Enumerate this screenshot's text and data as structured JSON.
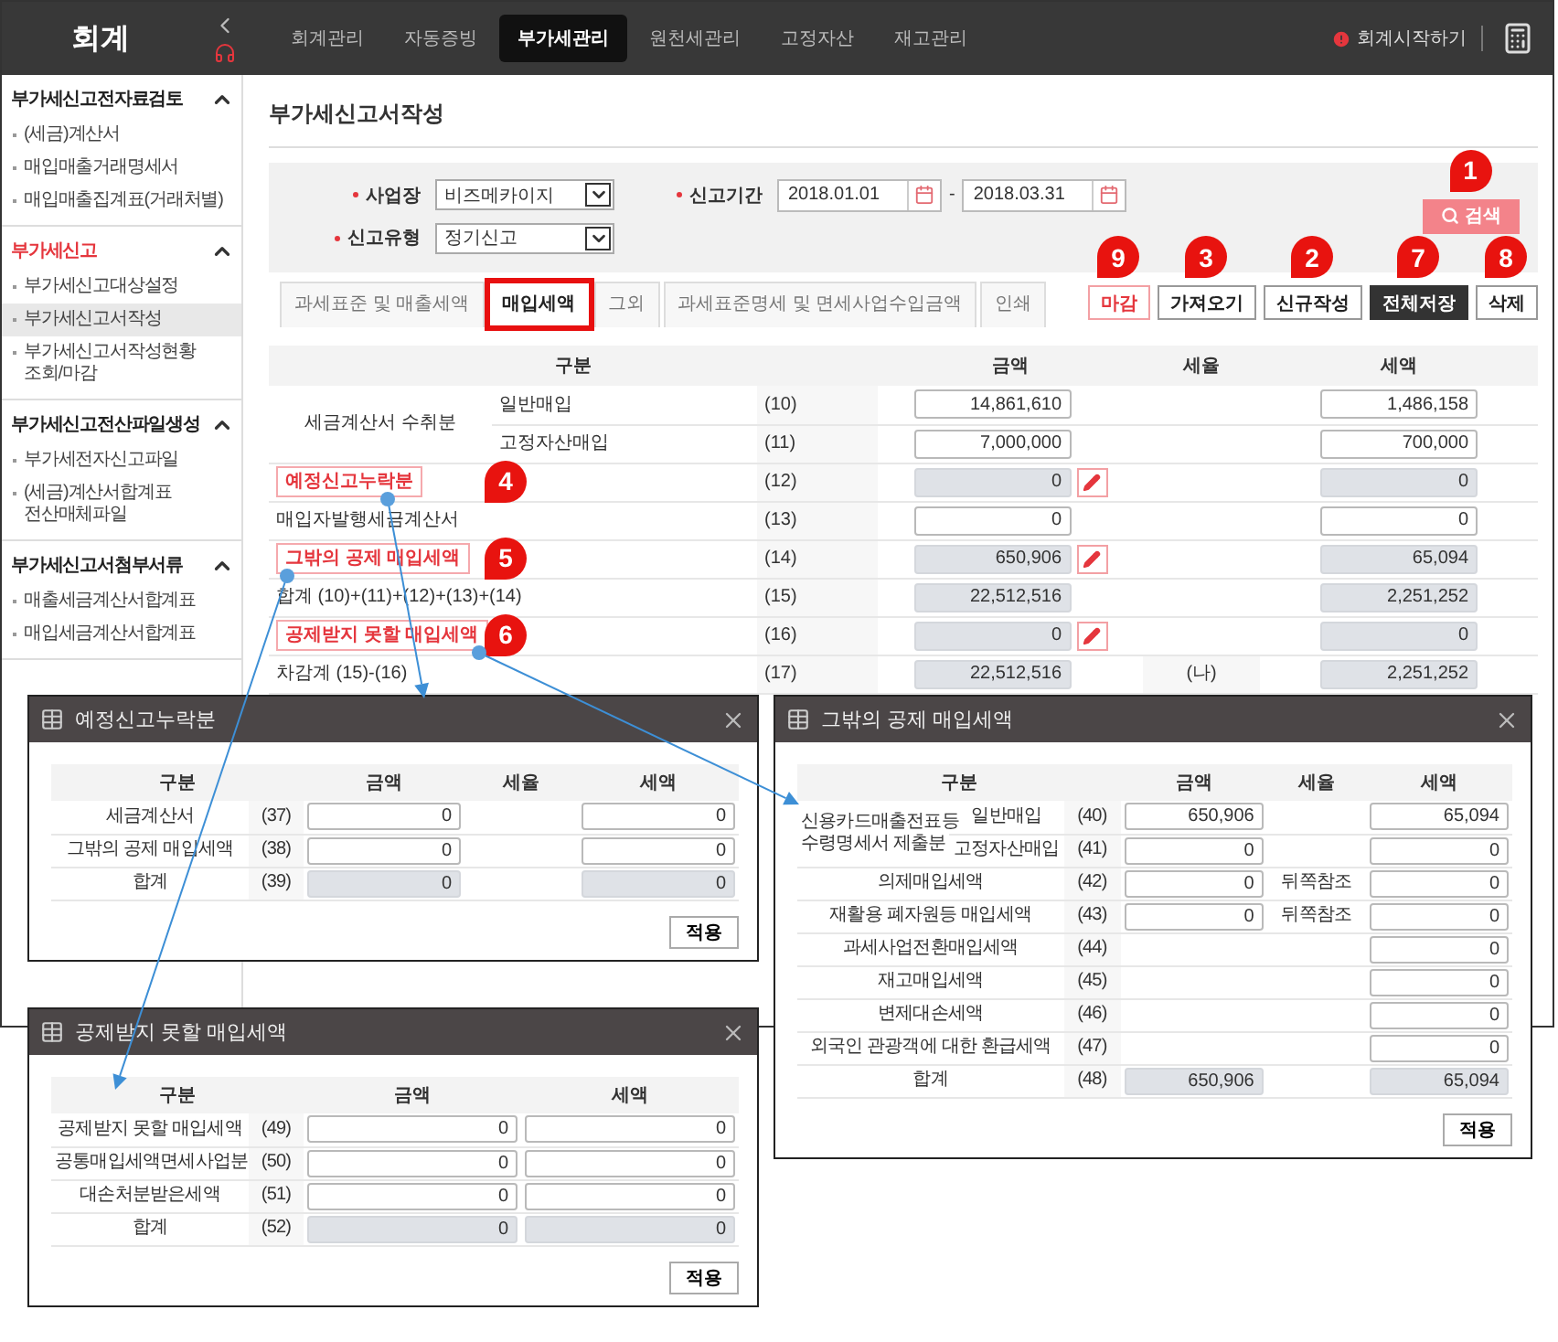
{
  "topbar": {
    "app_title": "회계",
    "menu": [
      {
        "label": "회계관리",
        "selected": false
      },
      {
        "label": "자동증빙",
        "selected": false
      },
      {
        "label": "부가세관리",
        "selected": true
      },
      {
        "label": "원천세관리",
        "selected": false
      },
      {
        "label": "고정자산",
        "selected": false
      },
      {
        "label": "재고관리",
        "selected": false
      }
    ],
    "start_link": "회계시작하기"
  },
  "sidebar": [
    {
      "title": "부가세신고전자료검토",
      "selected": false,
      "expanded": true,
      "items": [
        {
          "label": "(세금)계산서",
          "selected": false
        },
        {
          "label": "매입매출거래명세서",
          "selected": false
        },
        {
          "label": "매입매출집계표(거래처별)",
          "selected": false
        }
      ]
    },
    {
      "title": "부가세신고",
      "selected": true,
      "expanded": true,
      "items": [
        {
          "label": "부가세신고대상설정",
          "selected": false
        },
        {
          "label": "부가세신고서작성",
          "selected": true
        },
        {
          "label": "부가세신고서작성현황 조회/마감",
          "selected": false
        }
      ]
    },
    {
      "title": "부가세신고전산파일생성",
      "selected": false,
      "expanded": true,
      "items": [
        {
          "label": "부가세전자신고파일",
          "selected": false
        },
        {
          "label": "(세금)계산서합계표 전산매체파일",
          "selected": false
        }
      ]
    },
    {
      "title": "부가세신고서첨부서류",
      "selected": false,
      "expanded": true,
      "items": [
        {
          "label": "매출세금계산서합계표",
          "selected": false
        },
        {
          "label": "매입세금계산서합계표",
          "selected": false
        }
      ]
    }
  ],
  "page_title": "부가세신고서작성",
  "filters": {
    "business": {
      "label": "사업장",
      "value": "비즈메카이지"
    },
    "period": {
      "label": "신고기간",
      "from": "2018.01.01",
      "separator": "-",
      "to": "2018.03.31"
    },
    "report_type": {
      "label": "신고유형",
      "value": "정기신고"
    },
    "search_button": {
      "label": "검색",
      "callout": "1"
    }
  },
  "tabs": [
    {
      "label": "과세표준 및 매출세액",
      "selected": false,
      "highlighted": false
    },
    {
      "label": "매입세액",
      "selected": true,
      "highlighted": true
    },
    {
      "label": "그외",
      "selected": false,
      "highlighted": false
    },
    {
      "label": "과세표준명세 및 면세사업수입금액",
      "selected": false,
      "highlighted": false
    },
    {
      "label": "인쇄",
      "selected": false,
      "highlighted": false
    }
  ],
  "actions": [
    {
      "label": "마감",
      "kind": "accent",
      "callout": "9"
    },
    {
      "label": "가져오기",
      "kind": "plain",
      "callout": "3"
    },
    {
      "label": "신규작성",
      "kind": "plain",
      "callout": "2"
    },
    {
      "label": "전체저장",
      "kind": "dark",
      "callout": "7"
    },
    {
      "label": "삭제",
      "kind": "plain",
      "callout": "8"
    }
  ],
  "table": {
    "columns": [
      {
        "kind": "label",
        "label": "구분"
      },
      {
        "kind": "amount",
        "label": "금액"
      },
      {
        "kind": "rate",
        "label": "세율"
      },
      {
        "kind": "tax",
        "label": "세액"
      }
    ],
    "rows": [
      {
        "label": "세금계산서 수취분",
        "children": [
          {
            "label": "일반매입",
            "no": "(10)",
            "amount": {
              "value": "14,861,610",
              "readonly": false
            },
            "editable": false,
            "tax": {
              "value": "1,486,158",
              "readonly": false
            }
          },
          {
            "label": "고정자산매입",
            "no": "(11)",
            "amount": {
              "value": "7,000,000",
              "readonly": false
            },
            "editable": false,
            "tax": {
              "value": "700,000",
              "readonly": false
            }
          }
        ]
      },
      {
        "label": "예정신고누락분",
        "highlighted": true,
        "callout": "4",
        "no": "(12)",
        "amount": {
          "value": "0",
          "readonly": true
        },
        "editable": true,
        "tax": {
          "value": "0",
          "readonly": true
        }
      },
      {
        "label": "매입자발행세금계산서",
        "highlighted": false,
        "no": "(13)",
        "amount": {
          "value": "0",
          "readonly": false
        },
        "editable": false,
        "tax": {
          "value": "0",
          "readonly": false
        }
      },
      {
        "label": "그밖의 공제 매입세액",
        "highlighted": true,
        "callout": "5",
        "no": "(14)",
        "amount": {
          "value": "650,906",
          "readonly": true
        },
        "editable": true,
        "tax": {
          "value": "65,094",
          "readonly": true
        }
      },
      {
        "label": "합계 (10)+(11)+(12)+(13)+(14)",
        "highlighted": false,
        "no": "(15)",
        "amount": {
          "value": "22,512,516",
          "readonly": true
        },
        "editable": false,
        "tax": {
          "value": "2,251,252",
          "readonly": true
        }
      },
      {
        "label": "공제받지 못할 매입세액",
        "highlighted": true,
        "callout": "6",
        "no": "(16)",
        "amount": {
          "value": "0",
          "readonly": true
        },
        "editable": true,
        "tax": {
          "value": "0",
          "readonly": true
        }
      },
      {
        "label": "차감계 (15)-(16)",
        "highlighted": false,
        "no": "(17)",
        "amount": {
          "value": "22,512,516",
          "readonly": true
        },
        "editable": false,
        "rate": "(나)",
        "tax": {
          "value": "2,251,252",
          "readonly": true
        }
      }
    ]
  },
  "dialogs": [
    {
      "title": "예정신고누락분",
      "columns": [
        {
          "kind": "label",
          "label": "구분"
        },
        {
          "kind": "amount",
          "label": "금액"
        },
        {
          "kind": "rate",
          "label": "세율"
        },
        {
          "kind": "tax",
          "label": "세액"
        }
      ],
      "rows": [
        {
          "label": "세금계산서",
          "no": "(37)",
          "amount": {
            "value": "0",
            "readonly": false
          },
          "tax": {
            "value": "0",
            "readonly": false
          }
        },
        {
          "label": "그밖의 공제 매입세액",
          "no": "(38)",
          "amount": {
            "value": "0",
            "readonly": false
          },
          "tax": {
            "value": "0",
            "readonly": false
          }
        },
        {
          "label": "합계",
          "no": "(39)",
          "amount": {
            "value": "0",
            "readonly": true
          },
          "tax": {
            "value": "0",
            "readonly": true
          }
        }
      ],
      "apply_button": "적용"
    },
    {
      "title": "그밖의 공제 매입세액",
      "columns": [
        {
          "kind": "label",
          "label": "구분"
        },
        {
          "kind": "amount",
          "label": "금액"
        },
        {
          "kind": "rate",
          "label": "세율"
        },
        {
          "kind": "tax",
          "label": "세액"
        }
      ],
      "rows": [
        {
          "label": "신용카드매출전표등 수령명세서 제출분",
          "children": [
            {
              "label": "일반매입",
              "no": "(40)",
              "amount": {
                "value": "650,906",
                "readonly": false
              },
              "tax": {
                "value": "65,094",
                "readonly": false
              }
            },
            {
              "label": "고정자산매입",
              "no": "(41)",
              "amount": {
                "value": "0",
                "readonly": false
              },
              "tax": {
                "value": "0",
                "readonly": false
              }
            }
          ]
        },
        {
          "label": "의제매입세액",
          "no": "(42)",
          "amount": {
            "value": "0",
            "readonly": false
          },
          "rate": "뒤쪽참조",
          "tax": {
            "value": "0",
            "readonly": false
          }
        },
        {
          "label": "재활용 폐자원등 매입세액",
          "no": "(43)",
          "amount": {
            "value": "0",
            "readonly": false
          },
          "rate": "뒤쪽참조",
          "tax": {
            "value": "0",
            "readonly": false
          }
        },
        {
          "label": "과세사업전환매입세액",
          "no": "(44)",
          "tax": {
            "value": "0",
            "readonly": false
          }
        },
        {
          "label": "재고매입세액",
          "no": "(45)",
          "tax": {
            "value": "0",
            "readonly": false
          }
        },
        {
          "label": "변제대손세액",
          "no": "(46)",
          "tax": {
            "value": "0",
            "readonly": false
          }
        },
        {
          "label": "외국인 관광객에 대한 환급세액",
          "no": "(47)",
          "tax": {
            "value": "0",
            "readonly": false
          }
        },
        {
          "label": "합계",
          "no": "(48)",
          "amount": {
            "value": "650,906",
            "readonly": true
          },
          "tax": {
            "value": "65,094",
            "readonly": true
          }
        }
      ],
      "apply_button": "적용"
    },
    {
      "title": "공제받지 못할 매입세액",
      "columns": [
        {
          "kind": "label",
          "label": "구분"
        },
        {
          "kind": "amount",
          "label": "금액"
        },
        {
          "kind": "tax",
          "label": "세액"
        }
      ],
      "rows": [
        {
          "label": "공제받지 못할 매입세액",
          "no": "(49)",
          "amount": {
            "value": "0",
            "readonly": false
          },
          "tax": {
            "value": "0",
            "readonly": false
          }
        },
        {
          "label": "공통매입세액면세사업분",
          "no": "(50)",
          "amount": {
            "value": "0",
            "readonly": false
          },
          "tax": {
            "value": "0",
            "readonly": false
          }
        },
        {
          "label": "대손처분받은세액",
          "no": "(51)",
          "amount": {
            "value": "0",
            "readonly": false
          },
          "tax": {
            "value": "0",
            "readonly": false
          }
        },
        {
          "label": "합계",
          "no": "(52)",
          "amount": {
            "value": "0",
            "readonly": true
          },
          "tax": {
            "value": "0",
            "readonly": true
          }
        }
      ],
      "apply_button": "적용"
    }
  ]
}
